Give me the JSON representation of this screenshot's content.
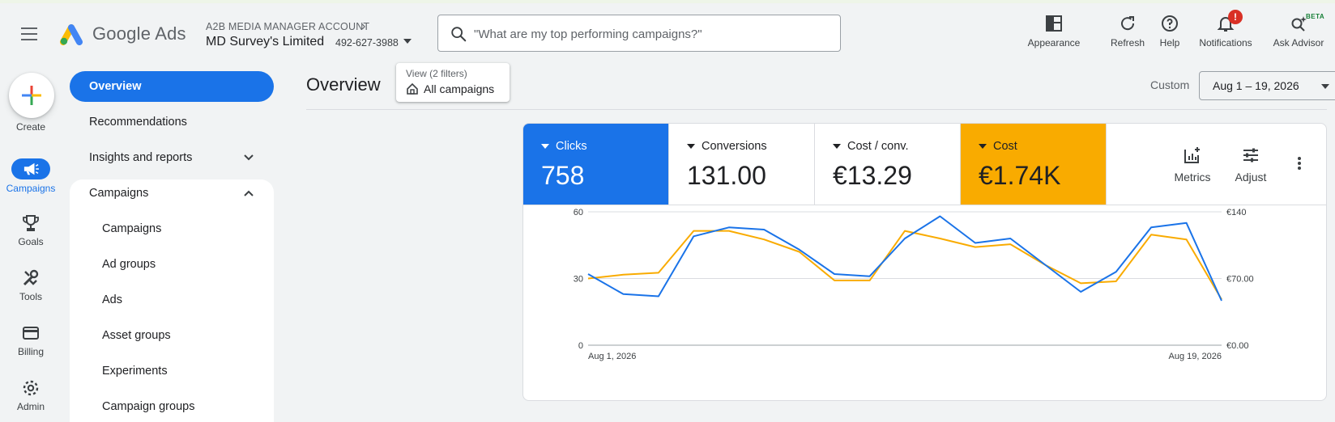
{
  "header": {
    "brand": "Google Ads",
    "account_label": "A2B MEDIA MANAGER ACCOUNT",
    "account_name": "MD Survey's Limited",
    "account_id": "492-627-3988",
    "search_placeholder": "\"What are my top performing campaigns?\"",
    "tools": [
      {
        "label": "Appearance",
        "icon": "appearance-icon"
      },
      {
        "label": "Refresh",
        "icon": "refresh-icon"
      },
      {
        "label": "Help",
        "icon": "help-icon"
      },
      {
        "label": "Notifications",
        "icon": "bell-icon",
        "badge": "!"
      },
      {
        "label": "Ask Advisor",
        "icon": "advisor-icon",
        "tag": "BETA"
      }
    ]
  },
  "rail": {
    "create": "Create",
    "items": [
      {
        "label": "Campaigns",
        "icon": "megaphone-icon",
        "active": true
      },
      {
        "label": "Goals",
        "icon": "trophy-icon"
      },
      {
        "label": "Tools",
        "icon": "tools-icon"
      },
      {
        "label": "Billing",
        "icon": "card-icon"
      },
      {
        "label": "Admin",
        "icon": "gear-icon"
      }
    ]
  },
  "nav": {
    "items": [
      {
        "label": "Overview",
        "active": true
      },
      {
        "label": "Recommendations"
      },
      {
        "label": "Insights and reports",
        "expandable": true
      },
      {
        "label": "Campaigns",
        "expanded": true
      },
      {
        "label": "Campaigns",
        "sub": true
      },
      {
        "label": "Ad groups",
        "sub": true
      },
      {
        "label": "Ads",
        "sub": true
      },
      {
        "label": "Asset groups",
        "sub": true
      },
      {
        "label": "Experiments",
        "sub": true
      },
      {
        "label": "Campaign groups",
        "sub": true
      }
    ]
  },
  "main": {
    "title": "Overview",
    "view_filters": "View (2 filters)",
    "view_scope": "All campaigns",
    "custom_label": "Custom",
    "date_range": "Aug 1 – 19, 2026"
  },
  "metrics": {
    "tiles": [
      {
        "name": "Clicks",
        "value": "758",
        "bg": "#1a73e8",
        "fg": "#ffffff"
      },
      {
        "name": "Conversions",
        "value": "131.00",
        "bg": "#ffffff",
        "fg": "#202124"
      },
      {
        "name": "Cost / conv.",
        "value": "€13.29",
        "bg": "#ffffff",
        "fg": "#202124"
      },
      {
        "name": "Cost",
        "value": "€1.74K",
        "bg": "#f9ab00",
        "fg": "#202124"
      }
    ],
    "metrics_btn": "Metrics",
    "adjust_btn": "Adjust"
  },
  "chart_data": {
    "type": "line",
    "x_start_label": "Aug 1, 2026",
    "x_end_label": "Aug 19, 2026",
    "left_ticks": [
      "0",
      "30",
      "60"
    ],
    "right_ticks": [
      "€0.00",
      "€70.00",
      "€140"
    ],
    "ylim_left": [
      0,
      60
    ],
    "ylim_right": [
      0,
      140
    ],
    "grid": true,
    "series": [
      {
        "name": "Clicks",
        "axis": "left",
        "color": "#1a73e8",
        "values": [
          32,
          23,
          22,
          49,
          53,
          52,
          43,
          32,
          31,
          48,
          58,
          46,
          48,
          36,
          24,
          33,
          53,
          55,
          20
        ]
      },
      {
        "name": "Cost",
        "axis": "right",
        "color": "#f9ab00",
        "values": [
          70,
          74,
          76,
          120,
          120,
          111,
          98,
          68,
          68,
          120,
          112,
          103,
          106,
          84,
          65,
          67,
          116,
          111,
          48
        ]
      }
    ]
  }
}
